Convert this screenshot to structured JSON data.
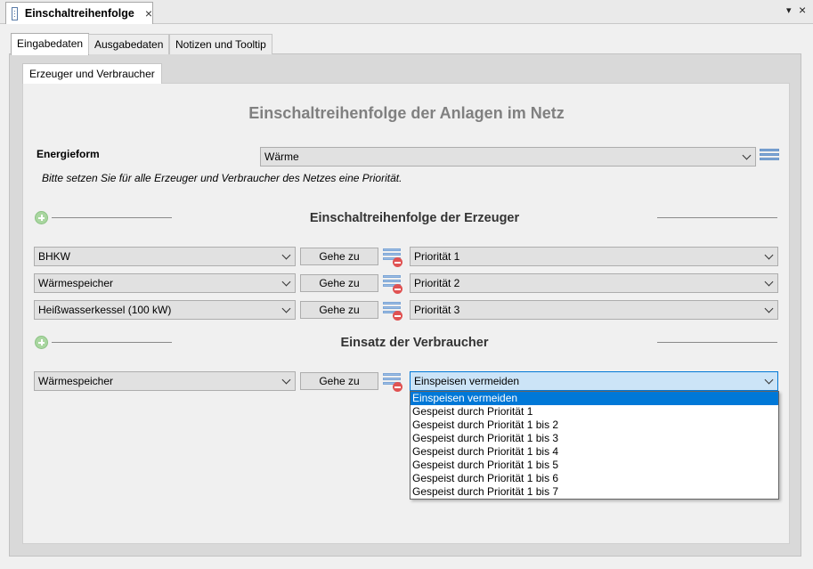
{
  "document_tab": {
    "title": "Einschaltreihenfolge",
    "close": "×"
  },
  "window_controls": {
    "menu": "▾",
    "close": "×"
  },
  "view_tabs": [
    "Eingabedaten",
    "Ausgabedaten",
    "Notizen und Tooltip"
  ],
  "sub_tab": "Erzeuger und Verbraucher",
  "main_title": "Einschaltreihenfolge der Anlagen im Netz",
  "energieform": {
    "label": "Energieform",
    "value": "Wärme"
  },
  "hint": "Bitte setzen Sie für alle Erzeuger und Verbraucher des Netzes eine Priorität.",
  "erzeuger": {
    "title": "Einschaltreihenfolge der Erzeuger",
    "rows": [
      {
        "plant": "BHKW",
        "button": "Gehe zu",
        "priority": "Priorität 1"
      },
      {
        "plant": "Wärmespeicher",
        "button": "Gehe zu",
        "priority": "Priorität 2"
      },
      {
        "plant": "Heißwasserkessel (100 kW)",
        "button": "Gehe zu",
        "priority": "Priorität 3"
      }
    ]
  },
  "verbraucher": {
    "title": "Einsatz der Verbraucher",
    "rows": [
      {
        "plant": "Wärmespeicher",
        "button": "Gehe zu",
        "priority": "Einspeisen vermeiden"
      }
    ]
  },
  "dropdown_options": [
    "Einspeisen vermeiden",
    "Gespeist durch Priorität 1",
    "Gespeist durch Priorität 1 bis 2",
    "Gespeist durch Priorität 1 bis 3",
    "Gespeist durch Priorität 1 bis 4",
    "Gespeist durch Priorität 1 bis 5",
    "Gespeist durch Priorität 1 bis 6",
    "Gespeist durch Priorität 1 bis 7"
  ],
  "colors": {
    "accent": "#0078d7",
    "title_gray": "#808080"
  }
}
